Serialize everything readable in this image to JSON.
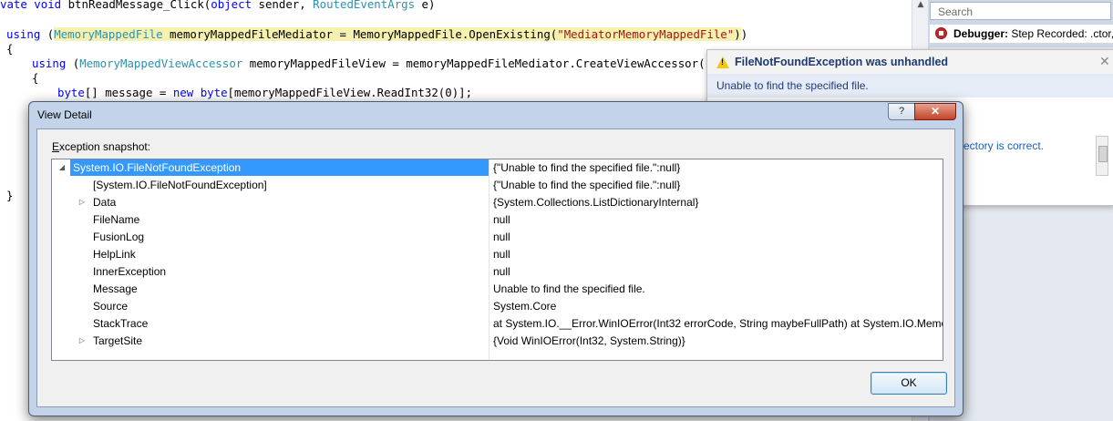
{
  "editor": {
    "lines": {
      "l1": {
        "kw": "vate void",
        "plain1": " btnReadMessage_Click(",
        "kw2": "object",
        "plain2": " sender, ",
        "type": "RoutedEventArgs",
        "plain3": " e)"
      },
      "l2": {
        "kw": "using",
        "p1": " (",
        "type": "MemoryMappedFile",
        "p2": " memoryMappedFileMediator = MemoryMappedFile.OpenExisting(",
        "str": "\"MediatorMemoryMappedFile\"",
        "p3": ")",
        "p4": ")"
      },
      "l3": {
        "text": "{"
      },
      "l4": {
        "kw": "using",
        "p1": " (",
        "type": "MemoryMappedViewAccessor",
        "p2": " memoryMappedFileView = memoryMappedFileMediator.CreateViewAccessor())"
      },
      "l5": {
        "text": "{"
      },
      "l6": {
        "kw": "byte",
        "p1": "[] message = ",
        "kw2": "new",
        "p2": " ",
        "kw3": "byte",
        "p3": "[memoryMappedFileView.ReadInt32(0)];"
      },
      "l7": {
        "text": "}"
      }
    }
  },
  "right_panel": {
    "search_placeholder": "Search",
    "event_label": "Debugger:",
    "event_text": " Step Recorded: .ctor,"
  },
  "exception_popup": {
    "title": "FileNotFoundException was unhandled",
    "message": "Unable to find the specified file.",
    "tip_link": "rectory is correct.",
    "close_glyph": "✕",
    "warn_glyph": "!"
  },
  "view_detail": {
    "title": "View Detail",
    "help_label": "?",
    "close_label": "✕",
    "snapshot_label_underlined": "E",
    "snapshot_label_rest": "xception snapshot:",
    "ok_label": "OK",
    "rows": [
      {
        "name": "System.IO.FileNotFoundException",
        "value": "{\"Unable to find the specified file.\":null}",
        "expander": "◢",
        "root": true,
        "selected": true
      },
      {
        "name": "[System.IO.FileNotFoundException]",
        "value": "{\"Unable to find the specified file.\":null}",
        "expander": ""
      },
      {
        "name": "Data",
        "value": "{System.Collections.ListDictionaryInternal}",
        "expander": "▷"
      },
      {
        "name": "FileName",
        "value": "null",
        "expander": ""
      },
      {
        "name": "FusionLog",
        "value": "null",
        "expander": ""
      },
      {
        "name": "HelpLink",
        "value": "null",
        "expander": ""
      },
      {
        "name": "InnerException",
        "value": "null",
        "expander": ""
      },
      {
        "name": "Message",
        "value": "Unable to find the specified file.",
        "expander": ""
      },
      {
        "name": "Source",
        "value": "System.Core",
        "expander": ""
      },
      {
        "name": "StackTrace",
        "value": "   at System.IO.__Error.WinIOError(Int32 errorCode, String maybeFullPath)   at System.IO.Memo",
        "expander": ""
      },
      {
        "name": "TargetSite",
        "value": "{Void WinIOError(Int32, System.String)}",
        "expander": "▷"
      }
    ]
  },
  "colors": {
    "keyword": "#0000ff",
    "type": "#2b91af",
    "string": "#a31515",
    "selection": "#3399ff",
    "dialog_frame": "#c3d4ea"
  }
}
